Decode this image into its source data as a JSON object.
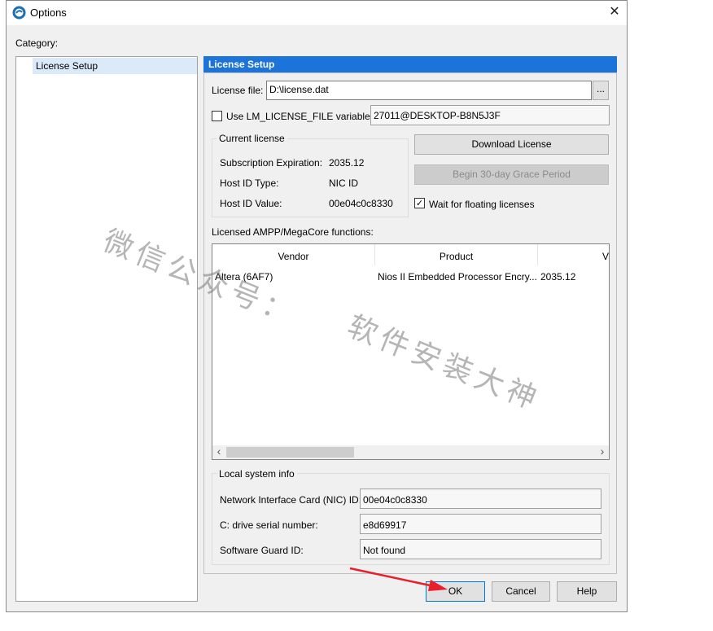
{
  "window": {
    "title": "Options",
    "close_glyph": "✕"
  },
  "category": {
    "label": "Category:",
    "items": [
      {
        "label": "License Setup"
      }
    ]
  },
  "license_setup": {
    "header": "License Setup",
    "license_file": {
      "label": "License file:",
      "value": "D:\\license.dat",
      "browse_label": "..."
    },
    "lm_license": {
      "label": "Use LM_LICENSE_FILE variable:",
      "value": "27011@DESKTOP-B8N5J3F",
      "checked": false
    },
    "current_license": {
      "title": "Current license",
      "rows": [
        {
          "label": "Subscription Expiration:",
          "value": "2035.12"
        },
        {
          "label": "Host ID Type:",
          "value": "NIC ID"
        },
        {
          "label": "Host ID Value:",
          "value": "00e04c0c8330"
        }
      ]
    },
    "download_label": "Download License",
    "grace_label": "Begin 30-day Grace Period",
    "wait_floating": {
      "label": "Wait for floating licenses",
      "checked": true,
      "check_glyph": "✓"
    },
    "functions": {
      "label": "Licensed AMPP/MegaCore functions:",
      "columns": [
        "Vendor",
        "Product",
        "V"
      ],
      "rows": [
        {
          "vendor": "Altera (6AF7)",
          "product": "Nios II Embedded Processor Encry...",
          "version": "2035.12"
        }
      ],
      "scroll_left": "‹",
      "scroll_right": "›"
    },
    "local_info": {
      "title": "Local system info",
      "rows": [
        {
          "label": "Network Interface Card (NIC) ID:",
          "value": "00e04c0c8330"
        },
        {
          "label": "C: drive serial number:",
          "value": "e8d69917"
        },
        {
          "label": "Software Guard ID:",
          "value": "Not found"
        }
      ]
    }
  },
  "buttons": {
    "ok": "OK",
    "cancel": "Cancel",
    "help": "Help"
  },
  "watermark": {
    "part1": "微信公众号：",
    "part2": "软件安装大神"
  },
  "colors": {
    "accent": "#1c73d9",
    "selection": "#dbeaf9",
    "annotation_arrow": "#e8202a"
  }
}
